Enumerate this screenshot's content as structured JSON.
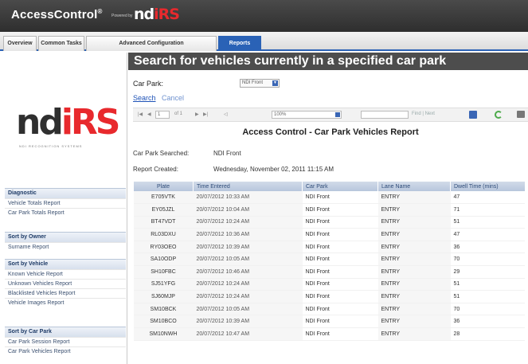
{
  "header": {
    "brand": "AccessControl",
    "brand_mark": "®",
    "powered_by": "Powered by",
    "logo_left": "nd",
    "logo_right": "iRS"
  },
  "tabs": [
    {
      "label": "Overview",
      "active": false
    },
    {
      "label": "Common Tasks",
      "active": false
    },
    {
      "label": "Advanced Configuration",
      "active": false
    },
    {
      "label": "Reports",
      "active": true
    }
  ],
  "sidebar": {
    "logo_left": "nd",
    "logo_right": "iRS",
    "logo_tagline": "NDI RECOGNITION SYSTEMS",
    "groups": [
      {
        "heading": "Diagnostic",
        "items": [
          "Vehicle Totals Report",
          "Car Park Totals Report"
        ]
      },
      {
        "heading": "Sort by Owner",
        "items": [
          "Surname Report"
        ]
      },
      {
        "heading": "Sort by Vehicle",
        "items": [
          "Known Vehicle Report",
          "Unknown Vehicles Report",
          "Blacklisted Vehicles Report",
          "Vehicle Images Report"
        ]
      },
      {
        "heading": "Sort by Car Park",
        "items": [
          "Car Park Session Report",
          "Car Park Vehicles Report"
        ]
      }
    ]
  },
  "page": {
    "title": "Search for vehicles currently in a specified car park",
    "car_park_label": "Car Park:",
    "car_park_value": "NDI Front",
    "search_link": "Search",
    "cancel_link": "Cancel"
  },
  "toolbar": {
    "page_current": "1",
    "page_of": "of 1",
    "zoom": "100%",
    "find_label": "Find | Next"
  },
  "report": {
    "title": "Access Control - Car Park Vehicles Report",
    "searched_label": "Car Park Searched:",
    "searched_value": "NDI Front",
    "created_label": "Report Created:",
    "created_value": "Wednesday, November 02, 2011 11:15 AM",
    "columns": [
      "Plate",
      "Time Entered",
      "Car Park",
      "Lane Name",
      "Dwell Time (mins)"
    ],
    "rows": [
      [
        "E705VTK",
        "20/07/2012 10:33 AM",
        "NDI Front",
        "ENTRY",
        "47"
      ],
      [
        "EY05JZL",
        "20/07/2012 10:04 AM",
        "NDI Front",
        "ENTRY",
        "71"
      ],
      [
        "BT47VDT",
        "20/07/2012 10:24 AM",
        "NDI Front",
        "ENTRY",
        "51"
      ],
      [
        "RL03DXU",
        "20/07/2012 10:36 AM",
        "NDI Front",
        "ENTRY",
        "47"
      ],
      [
        "RY03OEO",
        "20/07/2012 10:39 AM",
        "NDI Front",
        "ENTRY",
        "36"
      ],
      [
        "SA10ODP",
        "20/07/2012 10:05 AM",
        "NDI Front",
        "ENTRY",
        "70"
      ],
      [
        "SH10FBC",
        "20/07/2012 10:46 AM",
        "NDI Front",
        "ENTRY",
        "29"
      ],
      [
        "SJ51YFG",
        "20/07/2012 10:24 AM",
        "NDI Front",
        "ENTRY",
        "51"
      ],
      [
        "SJ60MJP",
        "20/07/2012 10:24 AM",
        "NDI Front",
        "ENTRY",
        "51"
      ],
      [
        "SM10BCK",
        "20/07/2012 10:05 AM",
        "NDI Front",
        "ENTRY",
        "70"
      ],
      [
        "SM10BCO",
        "20/07/2012 10:39 AM",
        "NDI Front",
        "ENTRY",
        "36"
      ],
      [
        "SM10NWH",
        "20/07/2012 10:47 AM",
        "NDI Front",
        "ENTRY",
        "28"
      ]
    ]
  }
}
